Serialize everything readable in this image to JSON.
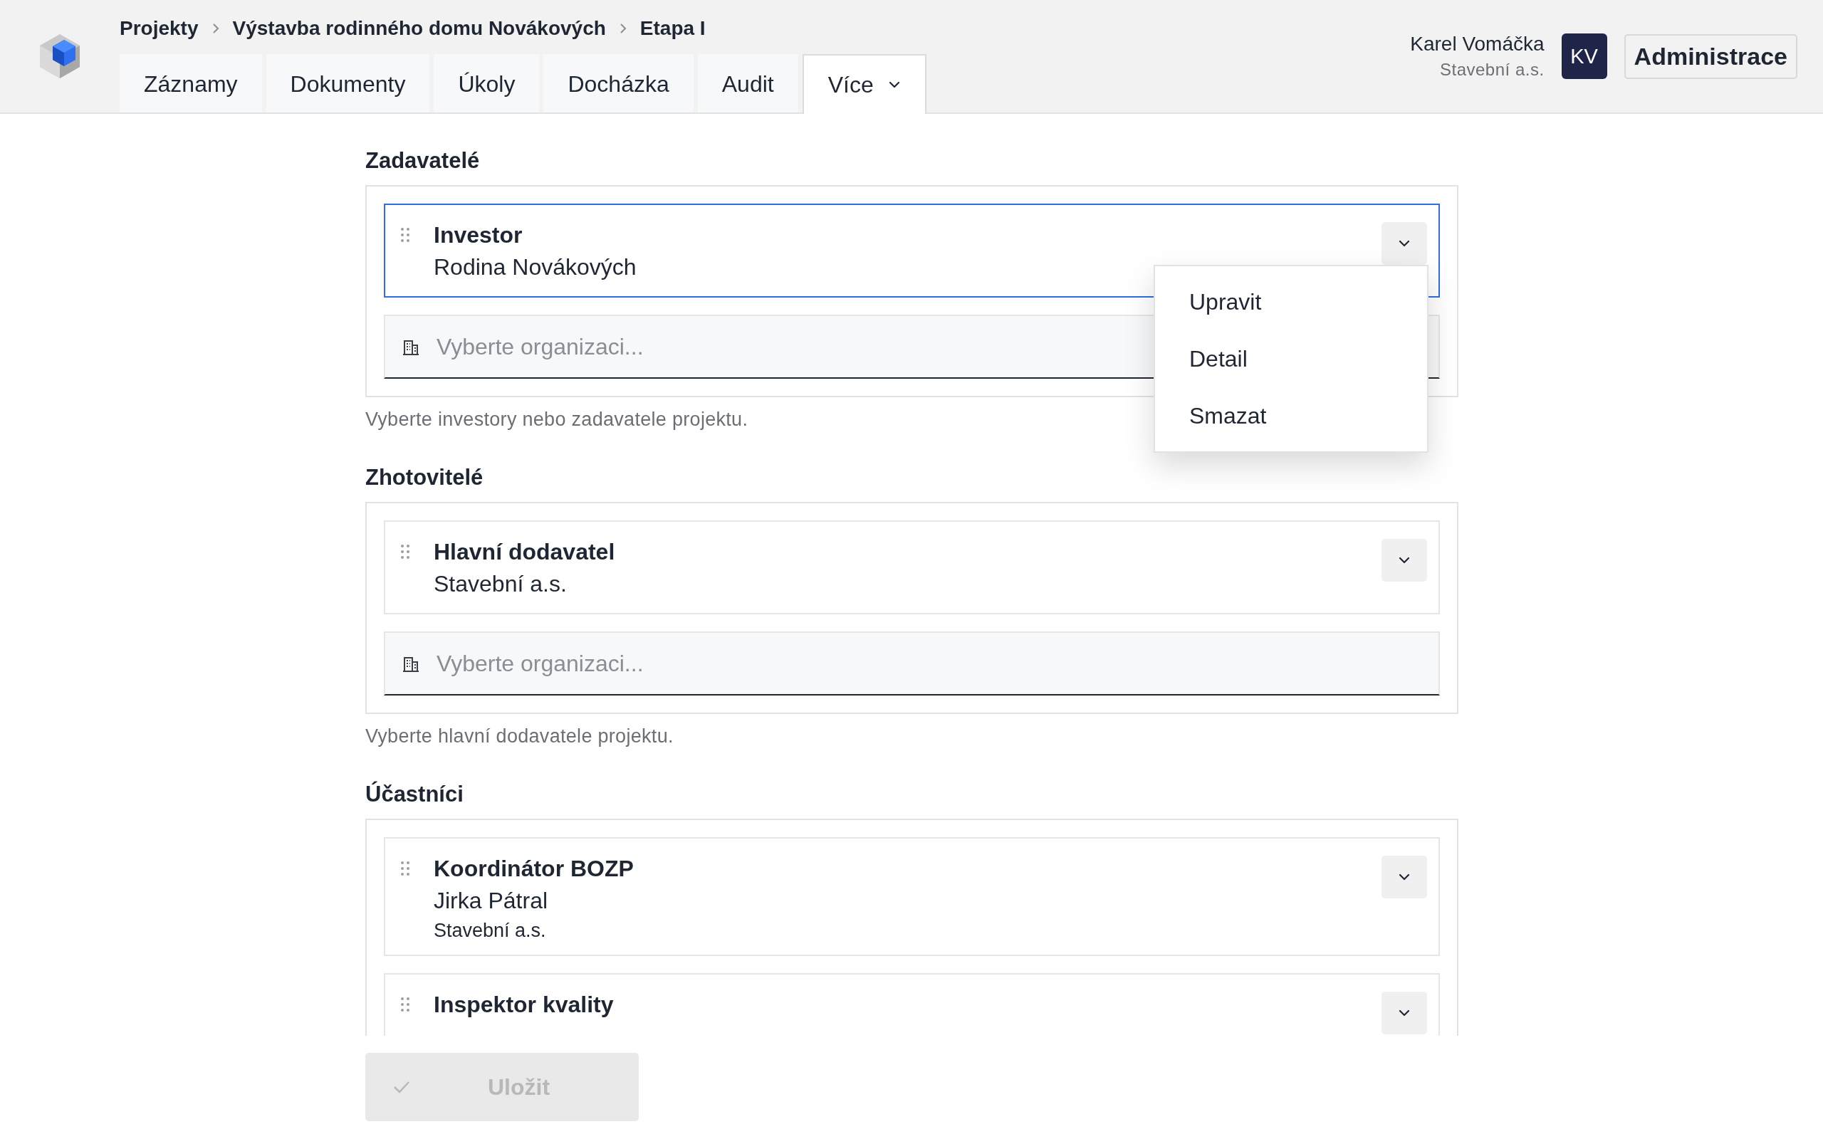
{
  "breadcrumb": [
    "Projekty",
    "Výstavba rodinného domu Novákových",
    "Etapa I"
  ],
  "tabs": [
    {
      "label": "Záznamy",
      "selected": false
    },
    {
      "label": "Dokumenty",
      "selected": false
    },
    {
      "label": "Úkoly",
      "selected": false
    },
    {
      "label": "Docházka",
      "selected": false
    },
    {
      "label": "Audit",
      "selected": false
    },
    {
      "label": "Více",
      "selected": true,
      "dropdown": true
    }
  ],
  "user": {
    "name": "Karel Vomáčka",
    "company": "Stavební a.s.",
    "initials": "KV"
  },
  "admin_button": "Administrace",
  "sections": [
    {
      "title": "Zadavatelé",
      "items": [
        {
          "role": "Investor",
          "name": "Rodina Novákových",
          "focused": true,
          "menu": [
            "Upravit",
            "Detail",
            "Smazat"
          ]
        }
      ],
      "field": {
        "placeholder": "Vyberte organizaci..."
      },
      "hint": "Vyberte investory nebo zadavatele projektu."
    },
    {
      "title": "Zhotovitelé",
      "items": [
        {
          "role": "Hlavní dodavatel",
          "name": "Stavební a.s.",
          "focused": false
        }
      ],
      "field": {
        "placeholder": "Vyberte organizaci..."
      },
      "hint": "Vyberte hlavní dodavatele projektu."
    },
    {
      "title": "Účastníci",
      "items": [
        {
          "role": "Koordinátor BOZP",
          "name": "Jirka Pátral",
          "org": "Stavební a.s.",
          "focused": false
        },
        {
          "role": "Inspektor kvality",
          "focused": false
        }
      ]
    }
  ],
  "save_button": {
    "label": "Uložit",
    "disabled": true
  }
}
